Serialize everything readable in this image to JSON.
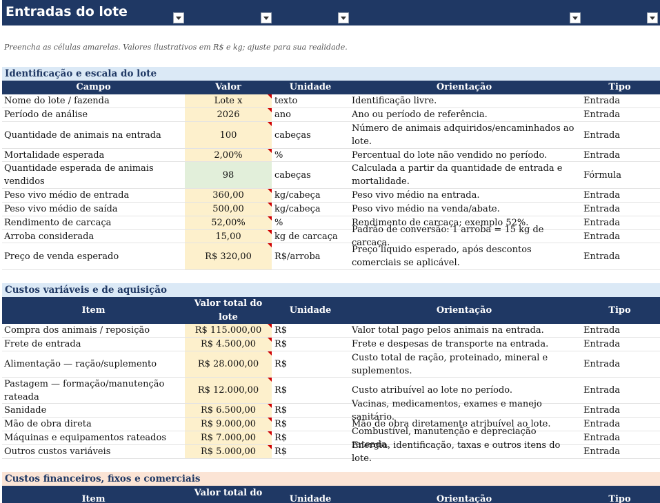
{
  "title": "Entradas do lote",
  "note": "Preencha as células amarelas. Valores ilustrativos em R$ e kg; ajuste para sua realidade.",
  "section1": {
    "title": "Identificação e escala do lote",
    "headers": [
      "Campo",
      "Valor",
      "Unidade",
      "Orientação",
      "Tipo"
    ],
    "rows": [
      {
        "campo": "Nome do lote / fazenda",
        "valor": "Lote x",
        "unidade": "texto",
        "orientacao": "Identificação livre.",
        "tipo": "Entrada"
      },
      {
        "campo": "Período de análise",
        "valor": "2026",
        "unidade": "ano",
        "orientacao": "Ano ou período de referência.",
        "tipo": "Entrada"
      },
      {
        "campo": "Quantidade de animais na entrada",
        "valor": "100",
        "unidade": "cabeças",
        "orientacao": "Número de animais adquiridos/encaminhados ao lote.",
        "tipo": "Entrada"
      },
      {
        "campo": "Mortalidade esperada",
        "valor": "2,00%",
        "unidade": "%",
        "orientacao": "Percentual do lote não vendido no período.",
        "tipo": "Entrada"
      },
      {
        "campo": "Quantidade esperada de animais vendidos",
        "valor": "98",
        "unidade": "cabeças",
        "orientacao": "Calculada a partir da quantidade de entrada e mortalidade.",
        "tipo": "Fórmula"
      },
      {
        "campo": "Peso vivo médio de entrada",
        "valor": "360,00",
        "unidade": "kg/cabeça",
        "orientacao": "Peso vivo médio na entrada.",
        "tipo": "Entrada"
      },
      {
        "campo": "Peso vivo médio de saída",
        "valor": "500,00",
        "unidade": "kg/cabeça",
        "orientacao": "Peso vivo médio na venda/abate.",
        "tipo": "Entrada"
      },
      {
        "campo": "Rendimento de carcaça",
        "valor": "52,00%",
        "unidade": "%",
        "orientacao": "Rendimento de carcaça; exemplo 52%.",
        "tipo": "Entrada"
      },
      {
        "campo": "Arroba considerada",
        "valor": "15,00",
        "unidade": "kg de carcaça",
        "orientacao": "Padrão de conversão: 1 arroba = 15 kg de carcaça.",
        "tipo": "Entrada"
      },
      {
        "campo": "Preço de venda esperado",
        "valor": "R$ 320,00",
        "unidade": "R$/arroba",
        "orientacao": "Preço líquido esperado, após descontos comerciais se aplicável.",
        "tipo": "Entrada"
      }
    ]
  },
  "section2": {
    "title": "Custos variáveis e de aquisição",
    "headers": [
      "Item",
      "Valor total do lote",
      "Unidade",
      "Orientação",
      "Tipo"
    ],
    "rows": [
      {
        "campo": "Compra dos animais / reposição",
        "valor": "R$ 115.000,00",
        "unidade": "R$",
        "orientacao": "Valor total pago pelos animais na entrada.",
        "tipo": "Entrada"
      },
      {
        "campo": "Frete de entrada",
        "valor": "R$ 4.500,00",
        "unidade": "R$",
        "orientacao": "Frete e despesas de transporte na entrada.",
        "tipo": "Entrada"
      },
      {
        "campo": "Alimentação — ração/suplemento",
        "valor": "R$ 28.000,00",
        "unidade": "R$",
        "orientacao": "Custo total de ração, proteinado, mineral e suplementos.",
        "tipo": "Entrada"
      },
      {
        "campo": "Pastagem — formação/manutenção rateada",
        "valor": "R$ 12.000,00",
        "unidade": "R$",
        "orientacao": "Custo atribuível ao lote no período.",
        "tipo": "Entrada"
      },
      {
        "campo": "Sanidade",
        "valor": "R$ 6.500,00",
        "unidade": "R$",
        "orientacao": "Vacinas, medicamentos, exames e manejo sanitário.",
        "tipo": "Entrada"
      },
      {
        "campo": "Mão de obra direta",
        "valor": "R$ 9.000,00",
        "unidade": "R$",
        "orientacao": "Mão de obra diretamente atribuível ao lote.",
        "tipo": "Entrada"
      },
      {
        "campo": "Máquinas e equipamentos rateados",
        "valor": "R$ 7.000,00",
        "unidade": "R$",
        "orientacao": "Combustível, manutenção e depreciação rateada.",
        "tipo": "Entrada"
      },
      {
        "campo": "Outros custos variáveis",
        "valor": "R$ 5.000,00",
        "unidade": "R$",
        "orientacao": "Energia, identificação, taxas e outros itens do lote.",
        "tipo": "Entrada"
      }
    ]
  },
  "section3": {
    "title": "Custos financeiros, fixos e comerciais",
    "headers": [
      "Item",
      "Valor total do",
      "Unidade",
      "Orientação",
      "Tipo"
    ]
  }
}
